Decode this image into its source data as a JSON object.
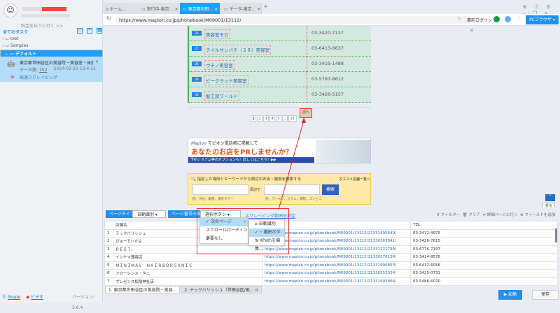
{
  "sidebar": {
    "pay_link": "料金を払うに行く >>",
    "all_tasks": "全てのタスク",
    "tree": [
      "test",
      "Samples",
      "デフォルト"
    ],
    "task": {
      "title": "東京都世田谷区の美容院・美容室・床屋一...",
      "data_label": "データ数:",
      "data_count": "152",
      "timestamp": "2024-02-23 13:4:22",
      "mode": "高速スクレイピング"
    },
    "skype": "Skype",
    "video": "ビデオ",
    "version": "バージョン: 3.6.4"
  },
  "tabs": [
    "ホーム...",
    "実行中-東京...",
    "東京都世田...",
    "データ-東京..."
  ],
  "address": {
    "url": "https://www.mapion.co.jp/phonebook/M09001/13112/",
    "login": "事前ログイン",
    "browser": "PCブラウザ"
  },
  "webpage": {
    "rows": [
      {
        "n": "26",
        "name": "美容室モカ",
        "tel": "03-3420-7137"
      },
      {
        "n": "27",
        "name": "テイルサンパチ（３８）美容室",
        "tel": "03-6413-6637"
      },
      {
        "n": "28",
        "name": "ウチノ美容室",
        "tel": "03-3419-1488"
      },
      {
        "n": "29",
        "name": "ビーグラッド美容室",
        "tel": "03-5787-8612"
      },
      {
        "n": "30",
        "name": "髪工房ワールド",
        "tel": "03-3426-5157"
      }
    ],
    "pages": [
      "1",
      "2",
      "3",
      "4",
      "5",
      "...",
      "21"
    ],
    "next": "次へ",
    "banner": {
      "brand": "Mapion",
      "line1": "マピオン電話帳に掲載して",
      "line2": "あなたのお店をPRしませんか？",
      "line3": "予約システム等のオプションも！詳しくはこちら！▶▶"
    },
    "search": {
      "title": "指定した場所とキーワードから周辺のお店・施設を検索する",
      "list_link": "オススメ店舗一覧へ",
      "near": "周辺で",
      "button": "検索",
      "hint1": "例：渋谷、銀座、東京タワー",
      "hint2": "例：ラーメン、カフェ、病院、コンビニ"
    },
    "fold": "折る"
  },
  "panel": {
    "page_type_label": "ページタイプ",
    "page_type_value": "自動識別",
    "page_num_label": "ページ番号の設定",
    "page_num_value": "選択ボタン",
    "scrape_range": "スクレイピング範囲を設定",
    "filter": "フィルター",
    "clear": "クリア",
    "detail": "詳細ページに行く",
    "add_field": "フィールドを追加",
    "menu1": [
      "次のページ",
      "スクロールローディング",
      "必要なし"
    ],
    "menu2": [
      "自動識別",
      "選択ボタン",
      "XPathを編集..."
    ],
    "columns": [
      "",
      "店舗名",
      "",
      "TEL"
    ],
    "rows": [
      [
        "1",
        "テックバリッシュ",
        "https://www.mapion.co.jp/phonebook/M09001/13112/21331495649/",
        "03-3412-4975"
      ],
      [
        "2",
        "ぴゅーでぃかよ",
        "https://www.mapion.co.jp/phonebook/M09001/13112/21330363841/",
        "03-3426-7615"
      ],
      [
        "3",
        "ＲＥＳＴ．",
        "https://www.mapion.co.jp/phonebook/M09001/13112/21331221799/",
        "03-6776-7197"
      ],
      [
        "4",
        "イシヤマ理容店",
        "https://www.mapion.co.jp/phonebook/M09001/13112/21330376154/",
        "03-3414-9576"
      ],
      [
        "5",
        "ＭＩＮＩＭＡＬ　ＨＡＩＲ＆ＯＲＧＡＮＩＣ",
        "https://www.mapion.co.jp/phonebook/M09001/13112/21331990853/",
        "03-6432-6056"
      ],
      [
        "6",
        "フローレンス・タニ",
        "https://www.mapion.co.jp/phonebook/M09001/13112/21330352024/",
        "03-3425-0731"
      ],
      [
        "7",
        "プレゼンス松陰神社店",
        "https://www.mapion.co.jp/phonebook/M09001/13112/21331605866/",
        "03-5486-6070"
      ]
    ],
    "bottom_tabs": [
      "1. 東京都世田谷区の美容院・美容...",
      "2. テックバリッシュ（世田谷区/美..."
    ],
    "start": "▶ 起動",
    "save": "保存"
  }
}
